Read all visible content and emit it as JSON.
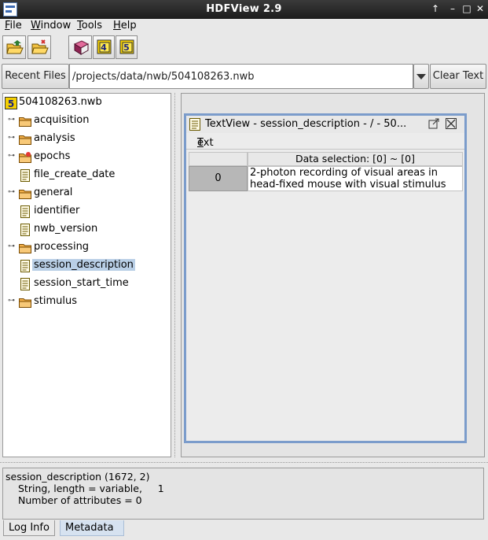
{
  "window": {
    "title": "HDFView 2.9"
  },
  "menubar": {
    "items": [
      {
        "accel": "F",
        "rest": "ile"
      },
      {
        "accel": "W",
        "rest": "indow"
      },
      {
        "accel": "T",
        "rest": "ools"
      },
      {
        "accel": "H",
        "rest": "elp"
      }
    ]
  },
  "toolbar": {
    "tools": [
      "open-file-icon",
      "close-file-icon",
      "users-guide-icon",
      "hdf4-library-icon",
      "hdf5-library-icon"
    ],
    "hdf4_label": "4",
    "hdf5_label": "5"
  },
  "address": {
    "recent_label": "Recent Files",
    "path": "/projects/data/nwb/504108263.nwb",
    "clear_label": "Clear Text"
  },
  "tree": {
    "root": {
      "label": "504108263.nwb",
      "badge": "5"
    },
    "items": [
      {
        "label": "acquisition",
        "kind": "folder"
      },
      {
        "label": "analysis",
        "kind": "folder"
      },
      {
        "label": "epochs",
        "kind": "folder"
      },
      {
        "label": "file_create_date",
        "kind": "dataset"
      },
      {
        "label": "general",
        "kind": "folder"
      },
      {
        "label": "identifier",
        "kind": "dataset"
      },
      {
        "label": "nwb_version",
        "kind": "dataset"
      },
      {
        "label": "processing",
        "kind": "folder"
      },
      {
        "label": "session_description",
        "kind": "dataset",
        "selected": true
      },
      {
        "label": "session_start_time",
        "kind": "dataset"
      },
      {
        "label": "stimulus",
        "kind": "folder"
      }
    ]
  },
  "textview": {
    "title": "TextView  -  session_description  -  /  -  50...",
    "menu_accel": "T",
    "menu_rest": "ext",
    "column_header": "Data selection:   [0] ~ [0]",
    "row_header": "0",
    "cell_line1": "2-photon recording of visual areas in",
    "cell_line2": "head-fixed mouse with visual stimulus"
  },
  "info": {
    "line1": "session_description (1672, 2)",
    "line2": "String, length = variable,     1",
    "line3": "Number of attributes = 0"
  },
  "tabs": {
    "log": "Log Info",
    "metadata": "Metadata"
  },
  "colors": {
    "selection": "#b9cfe6",
    "frame_border": "#7b9ccb",
    "titlebar": "#2a2a2a"
  }
}
